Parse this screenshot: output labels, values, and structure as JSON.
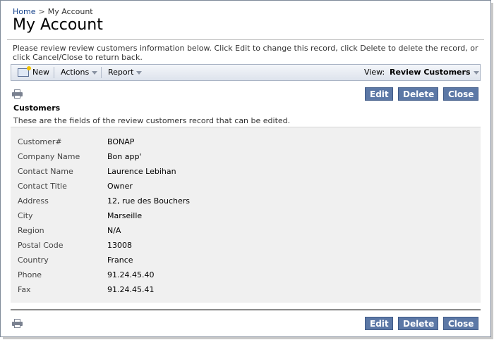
{
  "breadcrumb": {
    "home": "Home",
    "separator": ">",
    "current": "My Account"
  },
  "page": {
    "title": "My Account",
    "description": "Please review review customers information below. Click Edit to change this record, click Delete to delete the record, or click Cancel/Close to return back."
  },
  "toolbar": {
    "new_label": "New",
    "actions_label": "Actions",
    "report_label": "Report",
    "view_label": "View:",
    "view_value": "Review Customers"
  },
  "buttons": {
    "edit": "Edit",
    "delete": "Delete",
    "close": "Close"
  },
  "section": {
    "title": "Customers",
    "description": "These are the fields of the review customers record that can be edited."
  },
  "fields": [
    {
      "label": "Customer#",
      "value": "BONAP"
    },
    {
      "label": "Company Name",
      "value": "Bon app'"
    },
    {
      "label": "Contact Name",
      "value": "Laurence Lebihan"
    },
    {
      "label": "Contact Title",
      "value": "Owner"
    },
    {
      "label": "Address",
      "value": "12, rue des Bouchers"
    },
    {
      "label": "City",
      "value": "Marseille"
    },
    {
      "label": "Region",
      "value": "N/A"
    },
    {
      "label": "Postal Code",
      "value": "13008"
    },
    {
      "label": "Country",
      "value": "France"
    },
    {
      "label": "Phone",
      "value": "91.24.45.40"
    },
    {
      "label": "Fax",
      "value": "91.24.45.41"
    }
  ],
  "colors": {
    "button_bg": "#5c78a6",
    "link": "#15428b",
    "fields_bg": "#f0f0f0"
  },
  "icons": {
    "print": "printer-icon",
    "new": "new-record-icon",
    "dropdown": "chevron-down-icon"
  }
}
